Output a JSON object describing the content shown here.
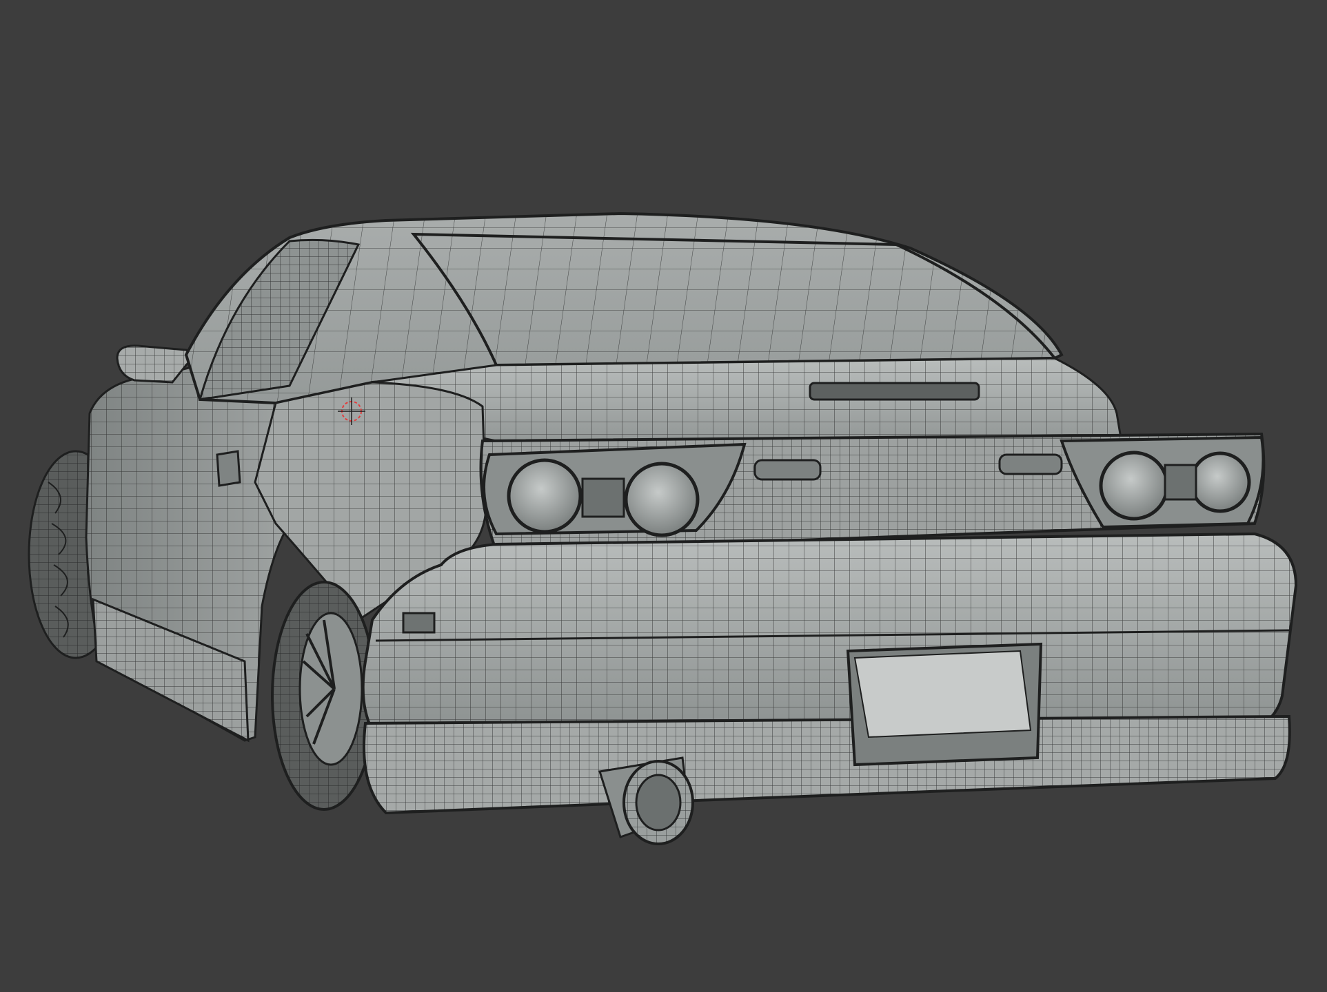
{
  "viewport": {
    "background_color": "#3d3d3d",
    "view_mode": "wireframe-overlay",
    "subject": "car-rear-three-quarter-mesh"
  },
  "colors": {
    "mesh_fill": "#9ea3a2",
    "mesh_fill_light": "#b4b8b7",
    "mesh_fill_dark": "#6f7473",
    "wire": "#1e1f1f",
    "plate": "#c8cbca",
    "tire": "#5a5d5c",
    "cursor_red": "#e23c3c"
  },
  "icons": {
    "cursor": "3d-cursor-icon"
  }
}
